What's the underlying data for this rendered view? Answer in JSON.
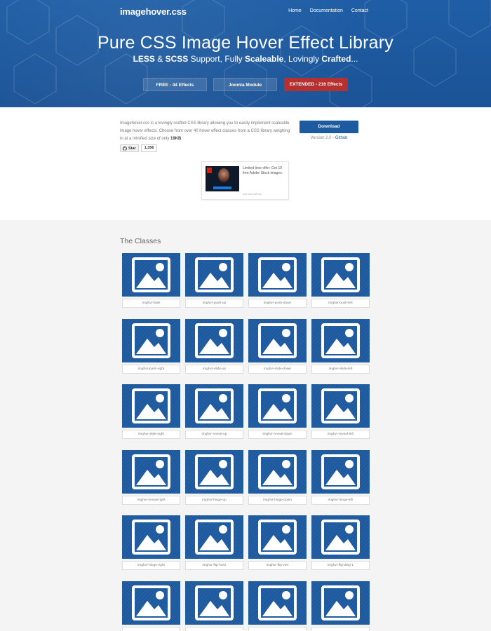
{
  "header": {
    "logo": "imagehover.css",
    "nav": [
      "Home",
      "Documentation",
      "Contact"
    ],
    "title": "Pure CSS Image Hover Effect Library",
    "subtitle_parts": [
      "LESS",
      " & ",
      "SCSS",
      " Support, Fully ",
      "Scaleable",
      ", Lovingly ",
      "Crafted",
      "..."
    ],
    "buttons": {
      "free": "FREE - 44 Effects",
      "joomla": "Joomla Module",
      "extended": "EXTENDED - 216 Effects"
    }
  },
  "intro": {
    "text": "Imagehover.css is a lovingly crafted CSS library allowing you to easily implement scaleable image hover effects. Choose from over 40 hover effect classes from a CSS library weighing in at a minified size of only ",
    "size": "19KB",
    "text_end": ".",
    "star_label": "Star",
    "star_count": "1,356",
    "download": "Download",
    "version": "Version 2.0 - ",
    "github": "Github"
  },
  "ad": {
    "text": "Limited time offer: Get 10 free Adobe Stock images.",
    "via": "ads via Carbon",
    "logo_letter": "A"
  },
  "classes": {
    "title": "The Classes",
    "items": [
      "imghvr-fade",
      "imghvr-push-up",
      "imghvr-push-down",
      "imghvr-push-left",
      "imghvr-push-right",
      "imghvr-slide-up",
      "imghvr-slide-down",
      "imghvr-slide-left",
      "imghvr-slide-right",
      "imghvr-reveal-up",
      "imghvr-reveal-down",
      "imghvr-reveal-left",
      "imghvr-reveal-right",
      "imghvr-hinge-up",
      "imghvr-hinge-down",
      "imghvr-hinge-left",
      "imghvr-hinge-right",
      "imghvr-flip-horiz",
      "imghvr-flip-vert",
      "imghvr-flip-diag-1",
      "",
      "",
      "",
      ""
    ]
  },
  "colors": {
    "brand_blue": "#1e5aa0",
    "extended_red": "#b5302f"
  }
}
